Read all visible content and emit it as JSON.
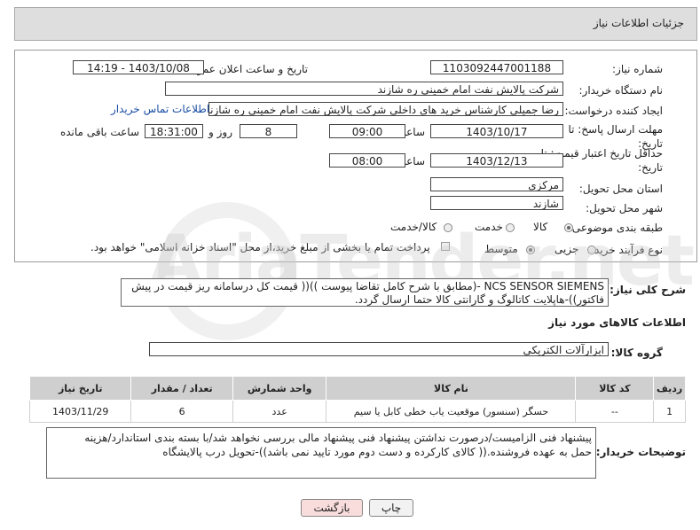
{
  "header": {
    "title": "جزئیات اطلاعات نیاز"
  },
  "form": {
    "need_number_label": "شماره نیاز:",
    "need_number": "1103092447001188",
    "announce_label": "تاریخ و ساعت اعلان عمومی:",
    "announce_value": "1403/10/08 - 14:19",
    "buyer_org_label": "نام دستگاه خریدار:",
    "buyer_org": "شرکت پالایش نفت امام خمینی  ره  شازند",
    "creator_label": "ایجاد کننده درخواست:",
    "creator": "رضا جمیلی کارشناس خرید های داخلی  شرکت پالایش نفت امام خمینی  ره  شازند",
    "contact_link": "اطلاعات تماس خریدار",
    "deadline_label_1": "مهلت ارسال پاسخ: تا",
    "deadline_label_2": "تاریخ:",
    "deadline_date": "1403/10/17",
    "time_label": "ساعت",
    "deadline_time": "09:00",
    "days": "8",
    "days_label": "روز و",
    "remaining_time": "18:31:00",
    "remaining_label": "ساعت باقی مانده",
    "validity_label_1": "حداقل تاریخ اعتبار قیمت: تا",
    "validity_label_2": "تاریخ:",
    "validity_date": "1403/12/13",
    "validity_time_label": "ساعت",
    "validity_time": "08:00",
    "province_label": "استان محل تحویل:",
    "province": "مرکزی",
    "city_label": "شهر محل تحویل:",
    "city": "شازند",
    "category_label": "طبقه بندی موضوعی:",
    "category_options": [
      "کالا",
      "خدمت",
      "کالا/خدمت"
    ],
    "category_selected": "کالا",
    "process_label": "نوع فرآیند خرید :",
    "process_options": [
      "جزیی",
      "متوسط"
    ],
    "process_selected": "متوسط",
    "payment_note": "پرداخت تمام یا بخشی از مبلغ خرید،از محل \"اسناد خزانه اسلامی\" خواهد بود."
  },
  "summary": {
    "label": "شرح کلی نیاز:",
    "text_line1": "NCS SENSOR SIEMENS -(مطابق با شرح کامل تقاضا پیوست ))(( قیمت کل درسامانه ریز قیمت در پیش",
    "text_line2": "فاکتور))-هاپلایت کاتالوگ و گارانتی کالا حتما ارسال گردد."
  },
  "goods": {
    "section_title": "اطلاعات کالاهای مورد نیاز",
    "group_label": "گروه کالا:",
    "group_value": "ابزارآلات الکتریکی",
    "columns": [
      "ردیف",
      "کد کالا",
      "نام کالا",
      "واحد شمارش",
      "تعداد / مقدار",
      "تاریخ نیاز"
    ],
    "rows": [
      {
        "row": "1",
        "code": "--",
        "name": "حسگر (سنسور) موقعیت یاب خطی کابل یا سیم",
        "unit": "عدد",
        "qty": "6",
        "date": "1403/11/29"
      }
    ]
  },
  "buyer_notes": {
    "label": "توضیحات خریدار:",
    "line1": "پیشنهاد فنی الزامیست/درصورت نداشتن پیشنهاد فنی پیشنهاد مالی بررسی نخواهد شد/با بسته بندی استاندارد/هزینه",
    "line2": "حمل به عهده فروشنده.(( کالای کارکرده و دست دوم مورد تایید نمی باشد))-تحویل درب پالایشگاه"
  },
  "buttons": {
    "print": "چاپ",
    "back": "بازگشت"
  },
  "watermark": {
    "text": "AriaTender.net"
  },
  "colors": {
    "link": "#1a4fa5",
    "header_bg": "#dedede",
    "table_header": "#cfcfcf",
    "back_button_bg": "#f9dcdc"
  }
}
